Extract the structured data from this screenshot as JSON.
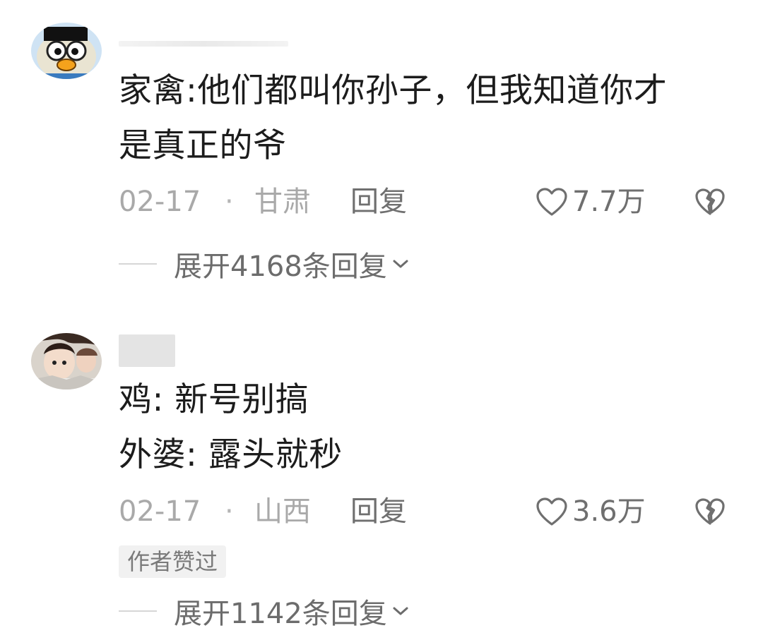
{
  "comments": [
    {
      "avatar_icon": "cartoon-face-avatar",
      "text_lines": [
        "家禽:他们都叫你孙子，但我知道你才",
        "是真正的爷"
      ],
      "date": "02-17",
      "separator": "·",
      "region": "甘肃",
      "reply_label": "回复",
      "like_icon": "heart-outline-icon",
      "like_count": "7.7万",
      "dislike_icon": "broken-heart-icon",
      "expand_label": "展开4168条回复",
      "expand_icon": "chevron-down-icon"
    },
    {
      "avatar_icon": "anime-character-avatar",
      "text_lines": [
        "鸡: 新号别搞",
        "外婆: 露头就秒"
      ],
      "date": "02-17",
      "separator": "·",
      "region": "山西",
      "reply_label": "回复",
      "like_icon": "heart-outline-icon",
      "like_count": "3.6万",
      "dislike_icon": "broken-heart-icon",
      "author_badge": "作者赞过",
      "expand_label": "展开1142条回复",
      "expand_icon": "chevron-down-icon"
    }
  ]
}
